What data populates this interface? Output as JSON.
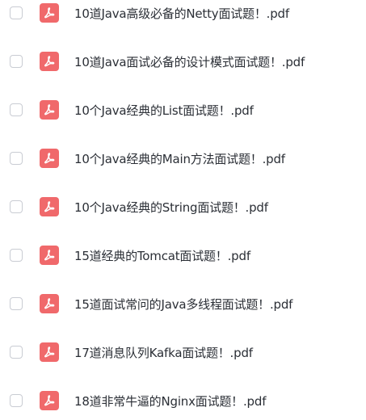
{
  "colors": {
    "pdf_icon_bg": "#f0696b",
    "pdf_icon_glyph": "#ffffff",
    "checkbox_border": "#c9ccd3",
    "text": "#2b2f36"
  },
  "icons": {
    "file_type": "pdf-icon",
    "select": "checkbox"
  },
  "files": [
    {
      "name": "10道Java高级必备的Netty面试题！.pdf",
      "checked": false
    },
    {
      "name": "10道Java面试必备的设计模式面试题！.pdf",
      "checked": false
    },
    {
      "name": "10个Java经典的List面试题！.pdf",
      "checked": false
    },
    {
      "name": "10个Java经典的Main方法面试题！.pdf",
      "checked": false
    },
    {
      "name": "10个Java经典的String面试题！.pdf",
      "checked": false
    },
    {
      "name": "15道经典的Tomcat面试题！.pdf",
      "checked": false
    },
    {
      "name": "15道面试常问的Java多线程面试题！.pdf",
      "checked": false
    },
    {
      "name": "17道消息队列Kafka面试题！.pdf",
      "checked": false
    },
    {
      "name": "18道非常牛逼的Nginx面试题！.pdf",
      "checked": false
    }
  ]
}
